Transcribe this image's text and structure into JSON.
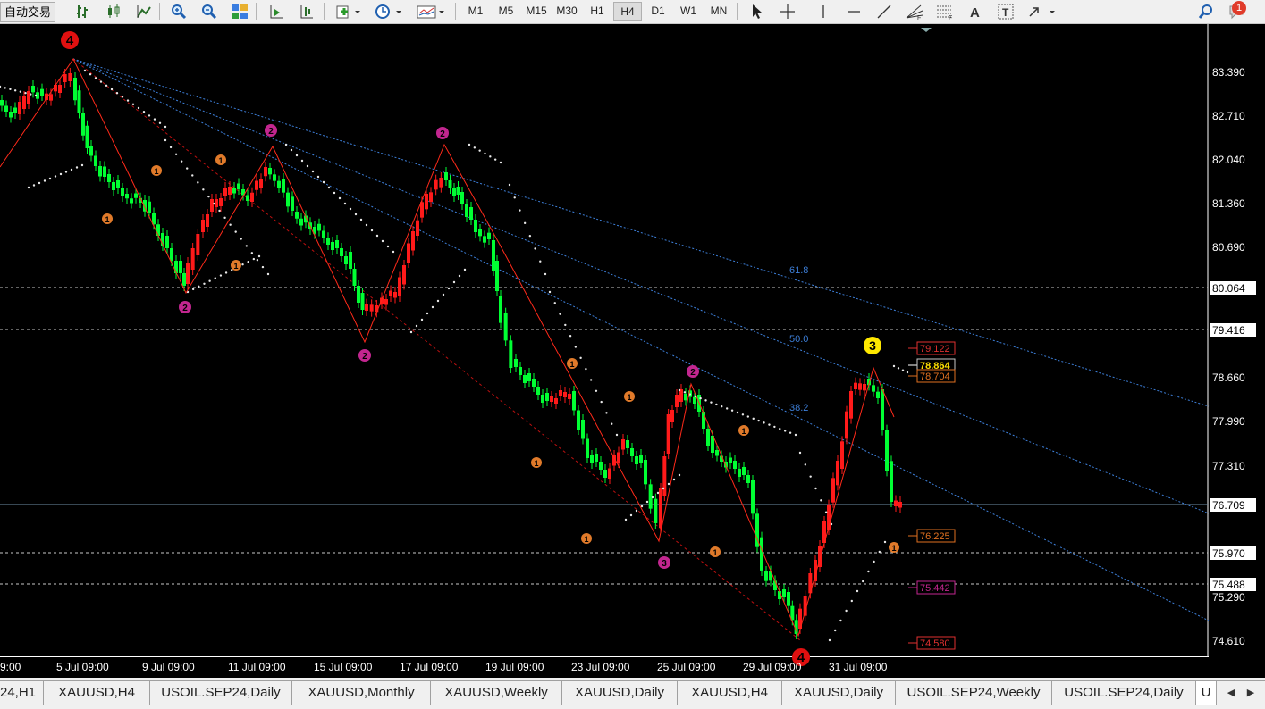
{
  "toolbar": {
    "autotrade_label": "自动交易",
    "timeframes": [
      "M1",
      "M5",
      "M15",
      "M30",
      "H1",
      "H4",
      "D1",
      "W1",
      "MN"
    ],
    "active_timeframe": "H4",
    "notification_count": "1"
  },
  "chart": {
    "price_labels": [
      "83.390",
      "82.710",
      "82.040",
      "81.360",
      "80.690",
      "78.660",
      "77.990",
      "77.310",
      "75.290",
      "74.610"
    ],
    "marked_prices": {
      "l80064": "80.064",
      "l79416": "79.416",
      "current": "76.709",
      "l75970": "75.970",
      "l75488": "75.488"
    },
    "date_labels": [
      "9:00",
      "5 Jul 09:00",
      "9 Jul 09:00",
      "11 Jul 09:00",
      "15 Jul 09:00",
      "17 Jul 09:00",
      "19 Jul 09:00",
      "23 Jul 09:00",
      "25 Jul 09:00",
      "29 Jul 09:00",
      "31 Jul 09:00"
    ],
    "fib_labels": [
      "61.8",
      "50.0",
      "38.2"
    ],
    "target_boxes": [
      "79.122",
      "78.864",
      "78.704",
      "76.225",
      "75.442",
      "74.580"
    ],
    "wave_labels": [
      "4",
      "2",
      "2",
      "2",
      "2",
      "2",
      "3",
      "4"
    ],
    "minor_label": "1",
    "colors": {
      "background": "#000000",
      "bull": "#ff1a1a",
      "bear": "#00ff33",
      "fib": "#3d7fd9",
      "wave": "#ff2a1a"
    }
  },
  "tabs": {
    "items": [
      "24,H1",
      "XAUUSD,H4",
      "USOIL.SEP24,Daily",
      "XAUUSD,Monthly",
      "XAUUSD,Weekly",
      "XAUUSD,Daily",
      "XAUUSD,H4",
      "XAUUSD,Daily",
      "USOIL.SEP24,Weekly",
      "USOIL.SEP24,Daily",
      "U"
    ]
  }
}
